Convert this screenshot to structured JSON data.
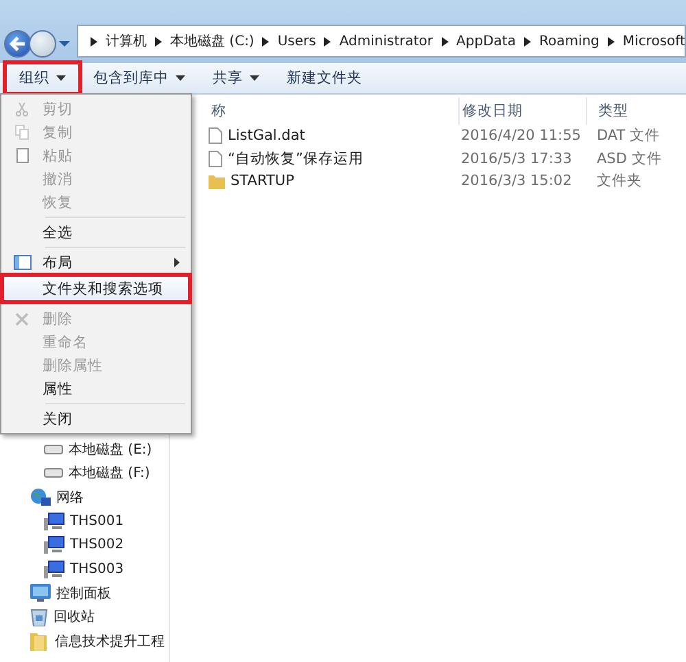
{
  "address_bar": {
    "path": [
      "计算机",
      "本地磁盘 (C:)",
      "Users",
      "Administrator",
      "AppData",
      "Roaming",
      "Microsoft"
    ]
  },
  "toolbar": [
    {
      "label": "组织",
      "dropdown": true,
      "highlighted": true
    },
    {
      "label": "包含到库中",
      "dropdown": true,
      "highlighted": false
    },
    {
      "label": "共享",
      "dropdown": true,
      "highlighted": false
    },
    {
      "label": "新建文件夹",
      "dropdown": false,
      "highlighted": false
    }
  ],
  "columns": [
    "称",
    "修改日期",
    "类型"
  ],
  "files": [
    {
      "kind": "file",
      "name": "ListGal.dat",
      "modified": "2016/4/20 11:55",
      "type": "DAT 文件"
    },
    {
      "kind": "file",
      "name": "“自动恢复”保存运用",
      "modified": "2016/5/3 17:33",
      "type": "ASD 文件"
    },
    {
      "kind": "folder",
      "name": "STARTUP",
      "modified": "2016/3/3 15:02",
      "type": "文件夹"
    }
  ],
  "nav_pane": [
    {
      "kind": "drive",
      "label": "本地磁盘 (E:)"
    },
    {
      "kind": "drive",
      "label": "本地磁盘 (F:)"
    },
    {
      "kind": "network",
      "label": "网络",
      "children": [
        {
          "kind": "computer",
          "label": "THS001"
        },
        {
          "kind": "computer",
          "label": "THS002"
        },
        {
          "kind": "computer",
          "label": "THS003"
        }
      ]
    },
    {
      "kind": "control-panel",
      "label": "控制面板"
    },
    {
      "kind": "recycle-bin",
      "label": "回收站"
    },
    {
      "kind": "folder",
      "label": "信息技术提升工程"
    }
  ],
  "menu": [
    {
      "kind": "cut",
      "label": "剪切",
      "disabled": true,
      "submenu": false,
      "highlighted": false
    },
    {
      "kind": "copy",
      "label": "复制",
      "disabled": true,
      "submenu": false,
      "highlighted": false
    },
    {
      "kind": "paste",
      "label": "粘贴",
      "disabled": true,
      "submenu": false,
      "highlighted": false
    },
    {
      "kind": "item",
      "label": "撤消",
      "disabled": true,
      "submenu": false,
      "highlighted": false
    },
    {
      "kind": "item",
      "label": "恢复",
      "disabled": true,
      "submenu": false,
      "highlighted": false
    },
    {
      "kind": "separator"
    },
    {
      "kind": "item",
      "label": "全选",
      "disabled": false,
      "submenu": false,
      "highlighted": false
    },
    {
      "kind": "separator"
    },
    {
      "kind": "layout",
      "label": "布局",
      "disabled": false,
      "submenu": true,
      "highlighted": false
    },
    {
      "kind": "item",
      "label": "文件夹和搜索选项",
      "disabled": false,
      "submenu": false,
      "highlighted": true
    },
    {
      "kind": "separator"
    },
    {
      "kind": "delete",
      "label": "删除",
      "disabled": true,
      "submenu": false,
      "highlighted": false
    },
    {
      "kind": "item",
      "label": "重命名",
      "disabled": true,
      "submenu": false,
      "highlighted": false
    },
    {
      "kind": "item",
      "label": "删除属性",
      "disabled": true,
      "submenu": false,
      "highlighted": false
    },
    {
      "kind": "item",
      "label": "属性",
      "disabled": false,
      "submenu": false,
      "highlighted": false
    },
    {
      "kind": "separator"
    },
    {
      "kind": "item",
      "label": "关闭",
      "disabled": false,
      "submenu": false,
      "highlighted": false
    }
  ]
}
